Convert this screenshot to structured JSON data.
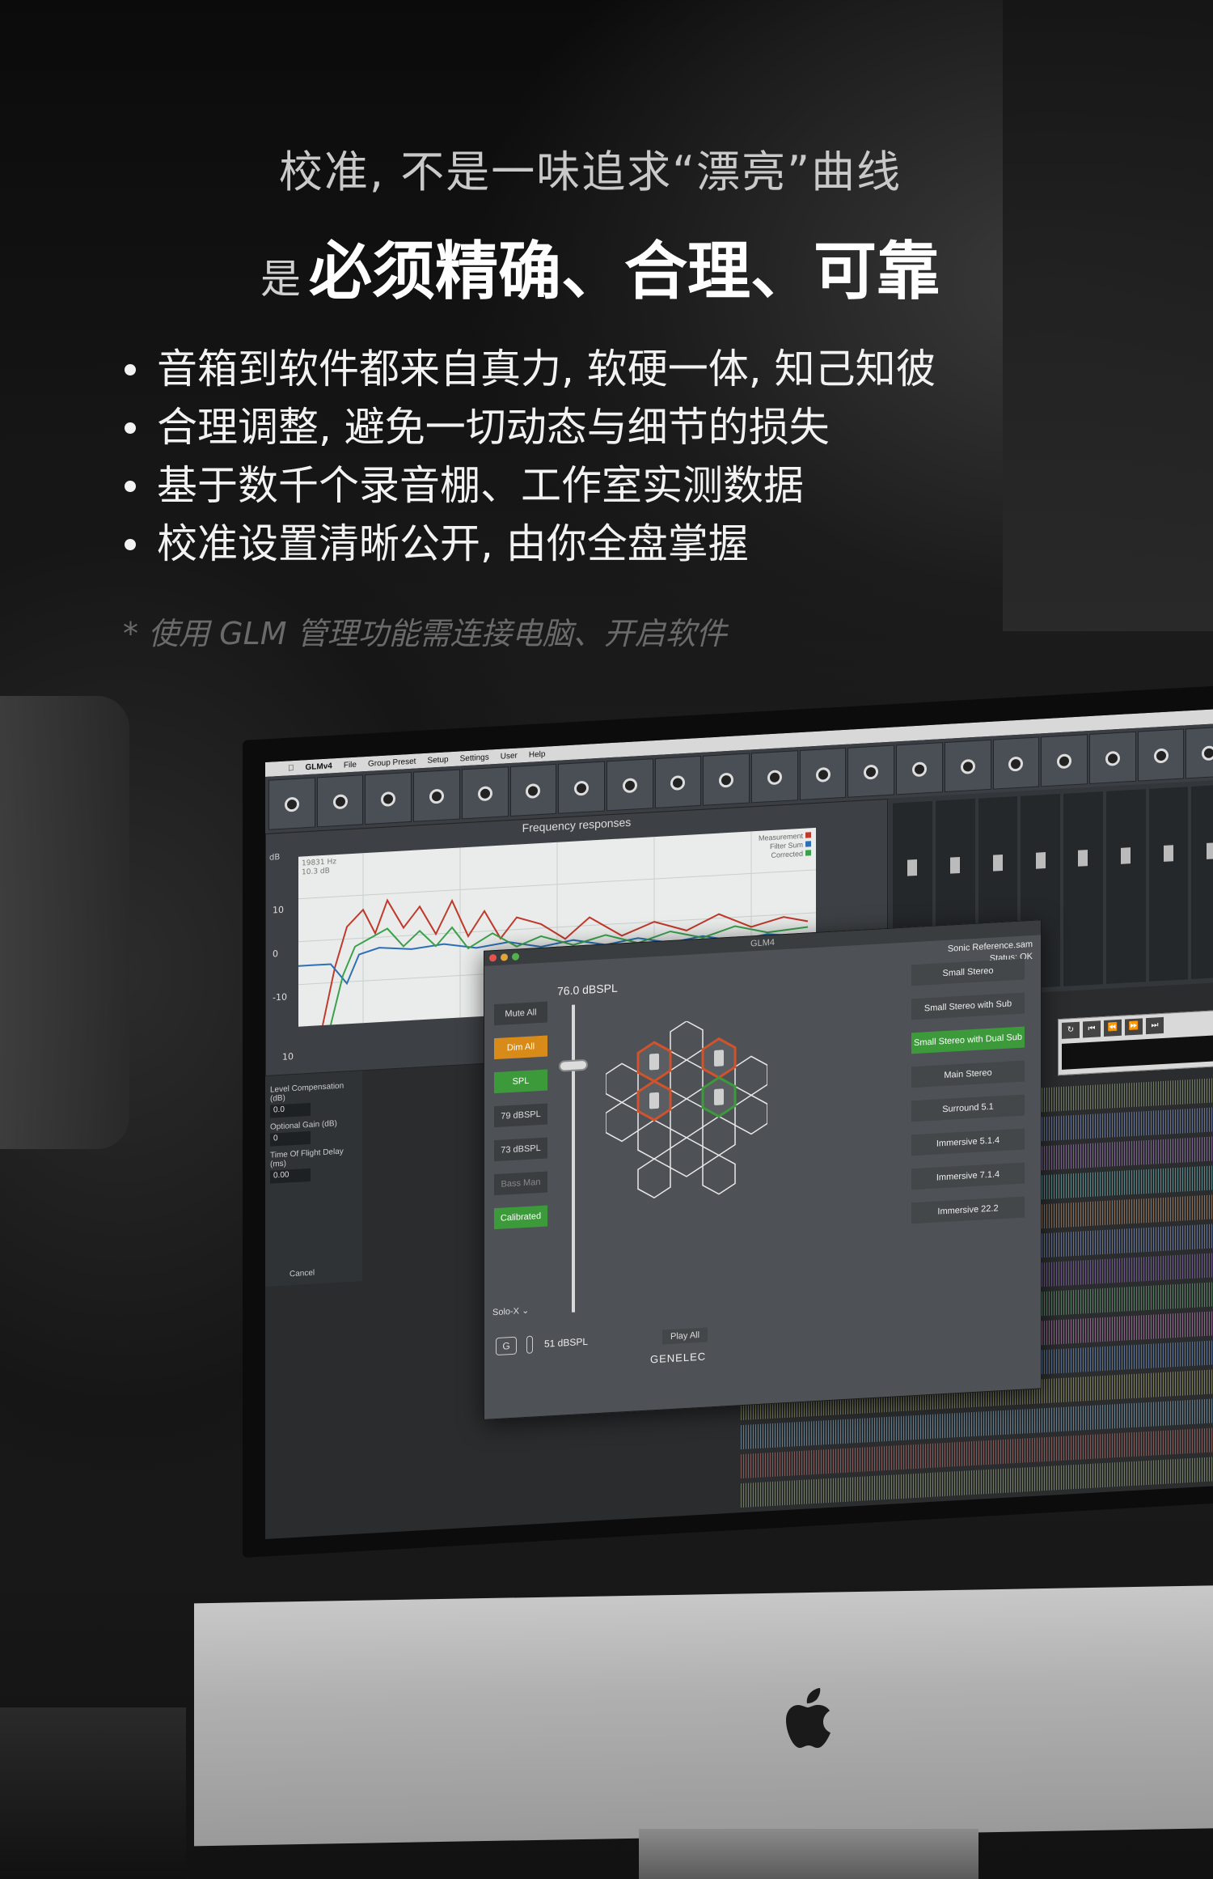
{
  "headline": {
    "line1": "校准, 不是一味追求“漂亮”曲线",
    "line2_lead": "是",
    "line2_bold": "必须精确、合理、可靠"
  },
  "bullets": [
    "音箱到软件都来自真力, 软硬一体, 知己知彼",
    "合理调整, 避免一切动态与细节的损失",
    "基于数千个录音棚、工作室实测数据",
    "校准设置清晰公开, 由你全盘掌握"
  ],
  "footnote": "* 使用 GLM 管理功能需连接电脑、开启软件",
  "menubar": {
    "app": "GLMv4",
    "items": [
      "File",
      "Group Preset",
      "Setup",
      "Settings",
      "User",
      "Help"
    ]
  },
  "freq_window": {
    "title": "Frequency responses",
    "unit": "dB",
    "readout_freq": "19831 Hz",
    "readout_db": "10.3 dB",
    "legend": [
      {
        "label": "Measurement",
        "color": "#c0392b"
      },
      {
        "label": "Filter Sum",
        "color": "#2c6fb5"
      },
      {
        "label": "Corrected",
        "color": "#3aa14a"
      }
    ],
    "y_ticks": [
      "10",
      "0",
      "-10"
    ],
    "x_start": "10"
  },
  "left_panel": {
    "level_comp_label": "Level Compensation (dB)",
    "level_comp_value": "0.0",
    "optional_gain_label": "Optional Gain (dB)",
    "optional_gain_value": "0",
    "tof_label": "Time Of Flight Delay (ms)",
    "tof_value": "0.00",
    "cancel": "Cancel"
  },
  "glm": {
    "title": "GLM4",
    "status_line1": "Sonic Reference.sam",
    "status_line2": "Status: OK",
    "spl_top": "76.0 dBSPL",
    "buttons": [
      {
        "label": "Mute All",
        "style": ""
      },
      {
        "label": "Dim All",
        "style": "orange"
      },
      {
        "label": "SPL",
        "style": "green"
      },
      {
        "label": "79 dBSPL",
        "style": ""
      },
      {
        "label": "73 dBSPL",
        "style": ""
      },
      {
        "label": "Bass Man",
        "style": "dim"
      },
      {
        "label": "Calibrated",
        "style": "green"
      }
    ],
    "solo": "Solo-X",
    "g_button": "G",
    "spl_bottom": "51 dBSPL",
    "play_all": "Play All",
    "logo": "GENELEC",
    "presets": [
      {
        "label": "Small Stereo",
        "active": false
      },
      {
        "label": "Small Stereo with Sub",
        "active": false
      },
      {
        "label": "Small Stereo with Dual Sub",
        "active": true
      },
      {
        "label": "Main Stereo",
        "active": false
      },
      {
        "label": "Surround 5.1",
        "active": false
      },
      {
        "label": "Immersive 5.1.4",
        "active": false
      },
      {
        "label": "Immersive 7.1.4",
        "active": false
      },
      {
        "label": "Immersive 22.2",
        "active": false
      }
    ]
  },
  "colors": {
    "orange": "#d98b1a",
    "green": "#3c9a3a",
    "red": "#c0392b",
    "blue": "#2c6fb5"
  }
}
